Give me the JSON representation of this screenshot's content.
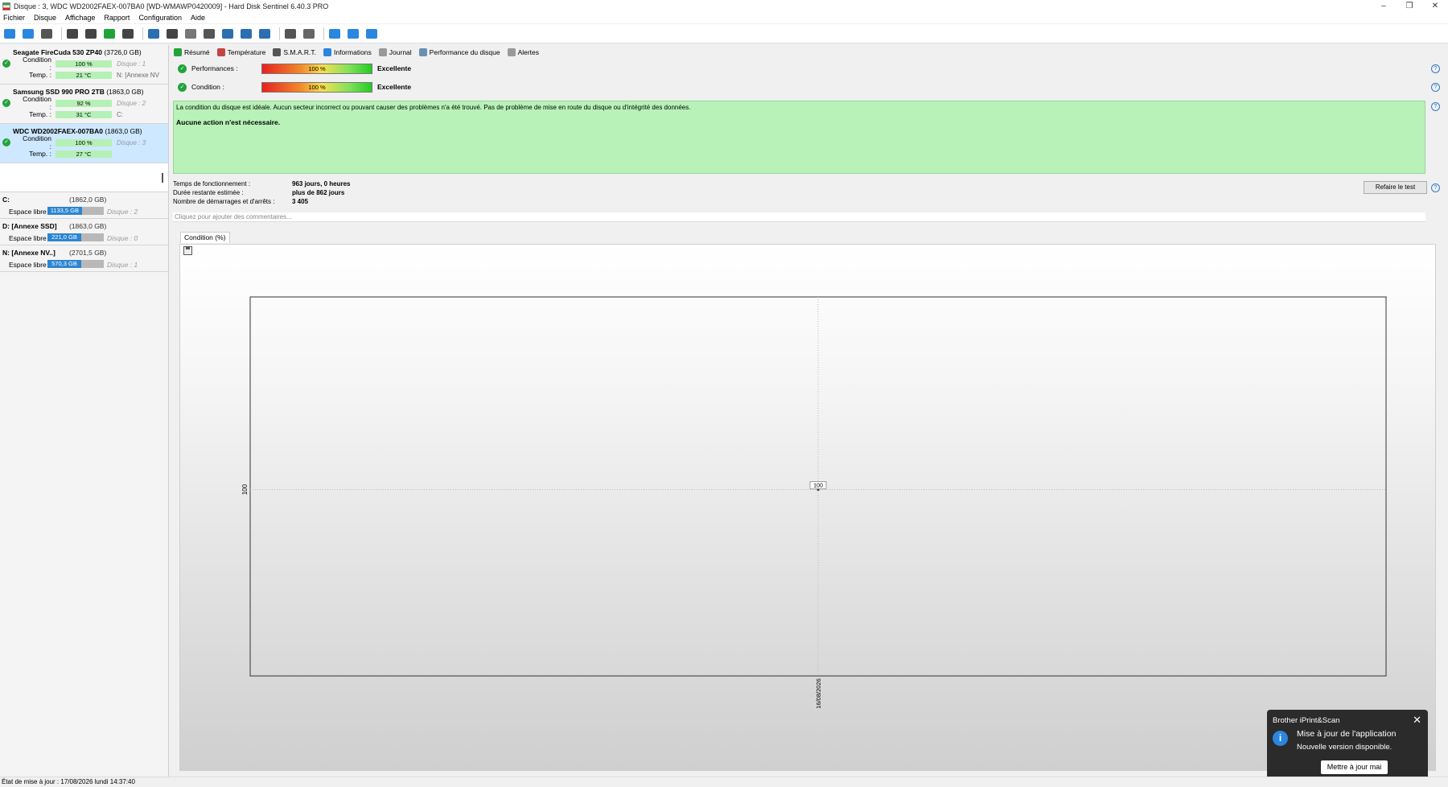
{
  "window": {
    "title": "Disque : 3, WDC WD2002FAEX-007BA0 [WD-WMAWP0420009]  -  Hard Disk Sentinel 6.40.3 PRO",
    "controls": [
      "–",
      "❐",
      "✕"
    ]
  },
  "menu": [
    "Fichier",
    "Disque",
    "Affichage",
    "Rapport",
    "Configuration",
    "Aide"
  ],
  "toolbar": {
    "buttons": [
      {
        "name": "refresh-icon",
        "color": "#2b86e0"
      },
      {
        "name": "refresh-all-icon",
        "color": "#2b86e0"
      },
      {
        "name": "disk-list-icon",
        "color": "#555555"
      },
      {
        "name": "drive-icon",
        "color": "#444444"
      },
      {
        "name": "drive-check-icon",
        "color": "#444444"
      },
      {
        "name": "drive-ok-icon",
        "color": "#22a33a"
      },
      {
        "name": "drive-tools-icon",
        "color": "#444444"
      },
      {
        "name": "globe-icon",
        "color": "#2b6fb0"
      },
      {
        "name": "eject-icon",
        "color": "#444444"
      },
      {
        "name": "tools-icon",
        "color": "#777777"
      },
      {
        "name": "print-icon",
        "color": "#555555"
      },
      {
        "name": "report-icon",
        "color": "#2b6fb0"
      },
      {
        "name": "mail-icon",
        "color": "#2b6fb0"
      },
      {
        "name": "web-report-icon",
        "color": "#2b6fb0"
      },
      {
        "name": "settings-icon",
        "color": "#555555"
      },
      {
        "name": "advanced-settings-icon",
        "color": "#666666"
      },
      {
        "name": "camera-icon",
        "color": "#2b86e0"
      },
      {
        "name": "help-icon",
        "color": "#2b86e0"
      },
      {
        "name": "about-icon",
        "color": "#2b86e0"
      }
    ]
  },
  "disks": [
    {
      "name": "Seagate FireCuda 530 ZP40",
      "size": "(3726,0 GB)",
      "condition_label": "Condition :",
      "condition": "100 %",
      "condition_note": "Disque : 1",
      "temp_label": "Temp. :",
      "temp": "21 °C",
      "temp_note": "N: [Annexe NV",
      "selected": false
    },
    {
      "name": "Samsung SSD 990 PRO 2TB",
      "size": "(1863,0 GB)",
      "condition_label": "Condition :",
      "condition": "92 %",
      "condition_note": "Disque : 2",
      "temp_label": "Temp. :",
      "temp": "31 °C",
      "temp_note": "C:",
      "selected": false
    },
    {
      "name": "WDC WD2002FAEX-007BA0",
      "size": "(1863,0 GB)",
      "condition_label": "Condition :",
      "condition": "100 %",
      "condition_note": "Disque : 3",
      "temp_label": "Temp. :",
      "temp": "27 °C",
      "temp_note": "",
      "selected": true
    }
  ],
  "partitions": [
    {
      "name": "C:",
      "size": "(1862,0 GB)",
      "free_label": "Espace libre",
      "free": "1133,5 GB",
      "free_fraction": 0.61,
      "disk": "Disque : 2"
    },
    {
      "name": "D: [Annexe SSD]",
      "size": "(1863,0 GB)",
      "free_label": "Espace libre",
      "free": "221,0 GB",
      "free_fraction": 0.6,
      "disk": "Disque : 0"
    },
    {
      "name": "N: [Annexe NV..]",
      "size": "(2701,5 GB)",
      "free_label": "Espace libre",
      "free": "570,3 GB",
      "free_fraction": 0.6,
      "disk": "Disque : 1"
    }
  ],
  "tabs": [
    {
      "label": "Résumé",
      "color": "#22a33a"
    },
    {
      "label": "Température",
      "color": "#c44444"
    },
    {
      "label": "S.M.A.R.T.",
      "color": "#555555"
    },
    {
      "label": "Informations",
      "color": "#2b86e0"
    },
    {
      "label": "Journal",
      "color": "#999999"
    },
    {
      "label": "Performance du disque",
      "color": "#6a8fb5"
    },
    {
      "label": "Alertes",
      "color": "#999999"
    }
  ],
  "summary": {
    "performance_label": "Performances :",
    "performance_value": "100 %",
    "performance_grade": "Excellente",
    "condition_label": "Condition :",
    "condition_value": "100 %",
    "condition_grade": "Excellente",
    "message": "La condition du disque est idéale. Aucun secteur incorrect ou pouvant causer des problèmes n'a été trouvé. Pas de problème de mise en route du disque ou d'intégrité des données.",
    "action": "Aucune action n'est nécessaire.",
    "uptime_label": "Temps de fonctionnement :",
    "uptime": "963 jours, 0 heures",
    "remaining_label": "Durée restante estimée :",
    "remaining": "plus de 862 jours",
    "starts_label": "Nombre de démarrages et d'arrêts :",
    "starts": "3 405",
    "retest_button": "Refaire le test",
    "comment_placeholder": "Cliquez pour ajouter des commentaires..."
  },
  "chart_tab": "Condition (%)",
  "chart_data": {
    "type": "line",
    "x": [
      "16/08/2026"
    ],
    "series": [
      {
        "values": [
          100
        ]
      }
    ],
    "ylabel": "",
    "xlabel": "",
    "y_tick_labels": [
      "100"
    ],
    "data_labels": [
      "100"
    ]
  },
  "toast": {
    "app": "Brother iPrint&Scan",
    "heading": "Mise à jour de l'application",
    "subtext": "Nouvelle version disponible.",
    "button": "Mettre à jour mai",
    "close": "✕",
    "icon": "i"
  },
  "statusbar": "État de mise à jour : 17/08/2026 lundi 14:37:40"
}
